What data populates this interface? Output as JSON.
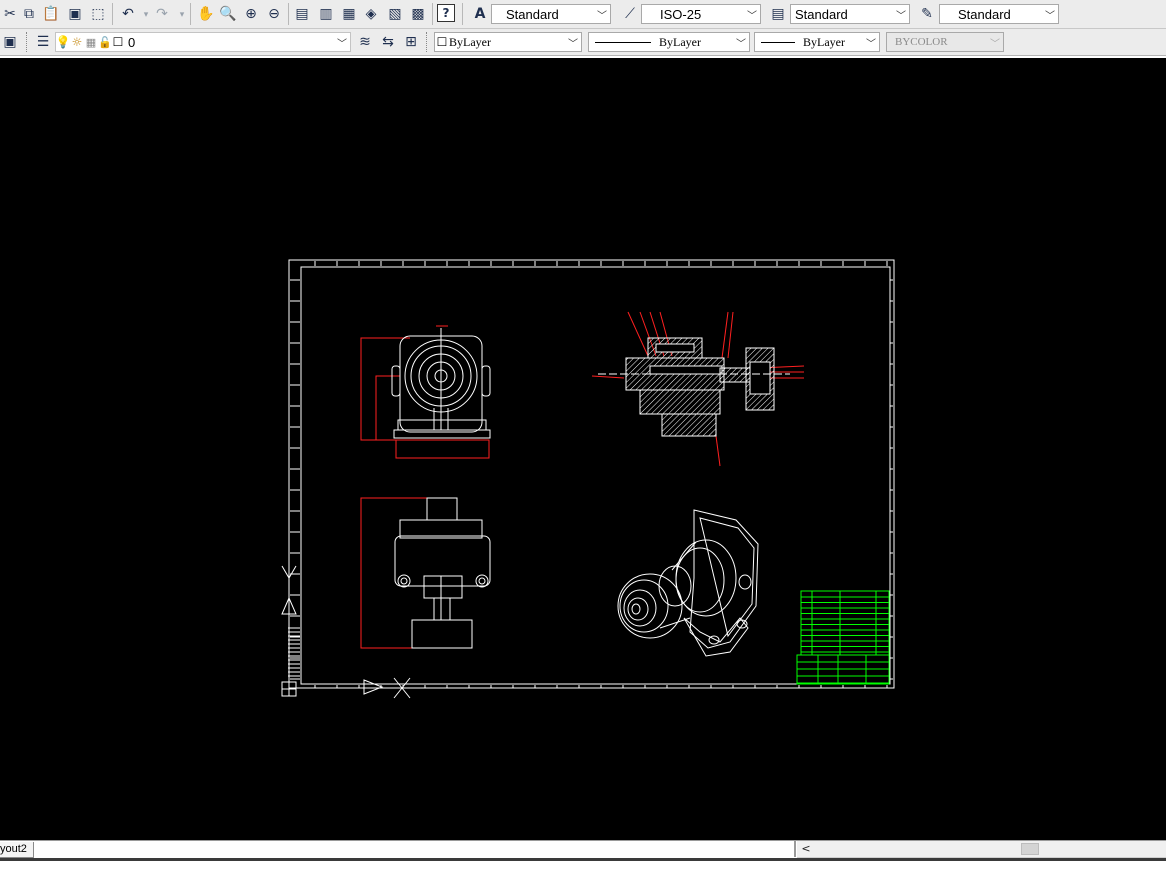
{
  "toolbar_top": {
    "text_style": "Standard",
    "dim_style": "ISO-25",
    "table_style": "Standard",
    "multileader_style": "Standard",
    "help_glyph": "?"
  },
  "toolbar_layers": {
    "current_layer": "0",
    "color": "ByLayer",
    "linetype": "ByLayer",
    "lineweight": "ByLayer",
    "plot_style": "BYCOLOR"
  },
  "tabs": {
    "layout2_label": "yout2",
    "scroll_left": "<"
  },
  "colors": {
    "canvas": "#000000",
    "drawing_lines": "#ffffff",
    "dimension_lines": "#ff0000",
    "title_block": "#00ff00"
  },
  "icons": [
    "cut-icon",
    "copy-icon",
    "paste-icon",
    "match-properties-icon",
    "block-editor-icon",
    "undo-icon",
    "redo-icon",
    "pan-icon",
    "zoom-realtime-icon",
    "zoom-window-icon",
    "zoom-previous-icon",
    "properties-icon",
    "design-center-icon",
    "tool-palettes-icon",
    "sheet-set-icon",
    "markup-icon",
    "calculator-icon",
    "help-icon",
    "layer-manager-icon",
    "layer-on-icon",
    "layer-freeze-icon",
    "layer-lock-icon",
    "make-current-icon",
    "layer-previous-icon",
    "layer-state-icon",
    "text-style-icon",
    "dim-style-icon",
    "table-style-icon",
    "multileader-style-icon"
  ]
}
